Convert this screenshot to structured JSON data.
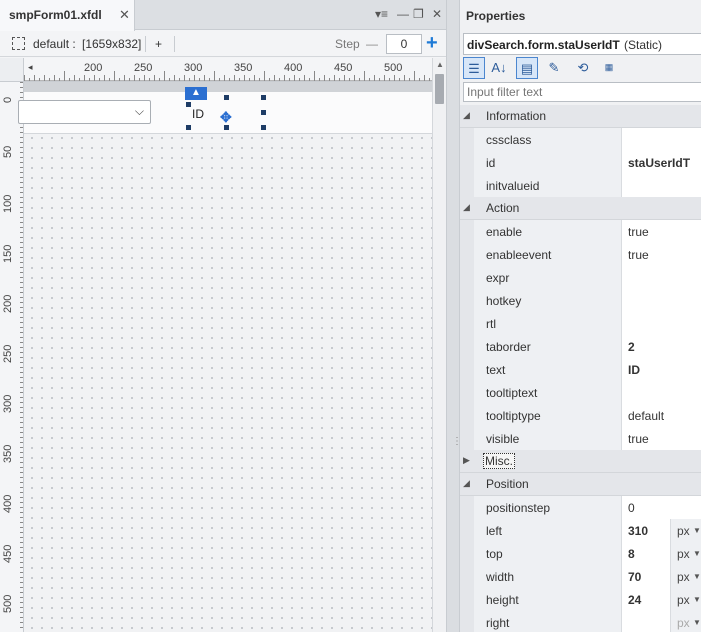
{
  "designer": {
    "tab_title": "smpForm01.xfdl",
    "tab_close": "✕",
    "win_controls": [
      "▾≡",
      "—",
      "❐",
      "✕"
    ],
    "toolbar": {
      "screen_label": "default :",
      "screen_size": "[1659x832]",
      "add_label": "+",
      "step_label": "Step",
      "step_minus": "—",
      "step_value": "0",
      "step_plus": "+"
    },
    "ruler_h": [
      "200",
      "250",
      "300",
      "350",
      "400",
      "450",
      "500"
    ],
    "ruler_v": [
      "0",
      "50",
      "100",
      "150",
      "200",
      "250",
      "300",
      "350",
      "400",
      "450",
      "500"
    ],
    "selected_static_text": "ID"
  },
  "properties": {
    "title": "Properties",
    "object_name": "divSearch.form.staUserIdT",
    "object_type": "(Static)",
    "filter_placeholder": "Input filter text",
    "toolbar_icons": [
      "category-sort-icon",
      "alpha-sort-icon",
      "properties-view-icon",
      "events-view-icon",
      "reset-icon",
      "init-icon"
    ],
    "categories": [
      {
        "name": "Information",
        "expanded": true,
        "props": [
          {
            "name": "cssclass",
            "value": ""
          },
          {
            "name": "id",
            "value": "staUserIdT",
            "bold": true
          },
          {
            "name": "initvalueid",
            "value": ""
          }
        ]
      },
      {
        "name": "Action",
        "expanded": true,
        "props": [
          {
            "name": "enable",
            "value": "true"
          },
          {
            "name": "enableevent",
            "value": "true"
          },
          {
            "name": "expr",
            "value": ""
          },
          {
            "name": "hotkey",
            "value": ""
          },
          {
            "name": "rtl",
            "value": ""
          },
          {
            "name": "taborder",
            "value": "2",
            "bold": true
          },
          {
            "name": "text",
            "value": "ID",
            "bold": true
          },
          {
            "name": "tooltiptext",
            "value": ""
          },
          {
            "name": "tooltiptype",
            "value": "default"
          },
          {
            "name": "visible",
            "value": "true"
          }
        ]
      },
      {
        "name": "Misc.",
        "expanded": false,
        "focused": true,
        "props": []
      },
      {
        "name": "Position",
        "expanded": true,
        "props": [
          {
            "name": "positionstep",
            "value": "0"
          },
          {
            "name": "left",
            "value": "310",
            "bold": true,
            "unit": "px"
          },
          {
            "name": "top",
            "value": "8",
            "bold": true,
            "unit": "px"
          },
          {
            "name": "width",
            "value": "70",
            "bold": true,
            "unit": "px"
          },
          {
            "name": "height",
            "value": "24",
            "bold": true,
            "unit": "px"
          },
          {
            "name": "right",
            "value": "",
            "unit": "px",
            "unit_disabled": true
          }
        ]
      }
    ]
  }
}
